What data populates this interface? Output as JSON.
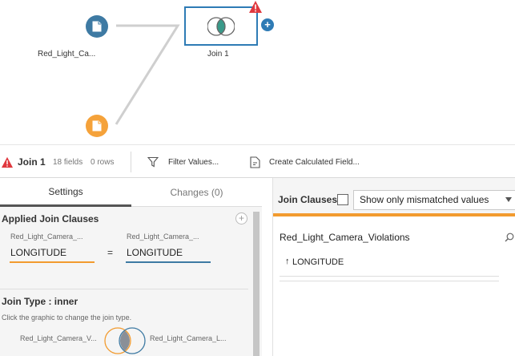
{
  "flow": {
    "input_node_1_label": "Red_Light_Ca...",
    "join_node_label": "Join 1",
    "colors": {
      "input_1": "#3e7aa3",
      "input_2": "#f5a23a",
      "accent": "#2e7bb5",
      "warning": "#e0383e"
    }
  },
  "toolbar": {
    "step_name": "Join 1",
    "fields_count": "18 fields",
    "rows_count": "0 rows",
    "filter_label": "Filter Values...",
    "calc_label": "Create Calculated Field..."
  },
  "settings": {
    "tab_settings": "Settings",
    "tab_changes": "Changes (0)",
    "applied_clauses_title": "Applied Join Clauses",
    "left_source": "Red_Light_Camera_...",
    "right_source": "Red_Light_Camera_...",
    "left_field": "LONGITUDE",
    "operator": "=",
    "right_field": "LONGITUDE",
    "join_type_title": "Join Type : inner",
    "join_type_hint": "Click the graphic to change the join type.",
    "venn_left_label": "Red_Light_Camera_V...",
    "venn_right_label": "Red_Light_Camera_L..."
  },
  "clauses": {
    "title": "Join Clauses",
    "mismatch_option": "Show only mismatched values",
    "source_name": "Red_Light_Camera_Violations",
    "sort_arrow": "↑",
    "field_name": "LONGITUDE"
  }
}
